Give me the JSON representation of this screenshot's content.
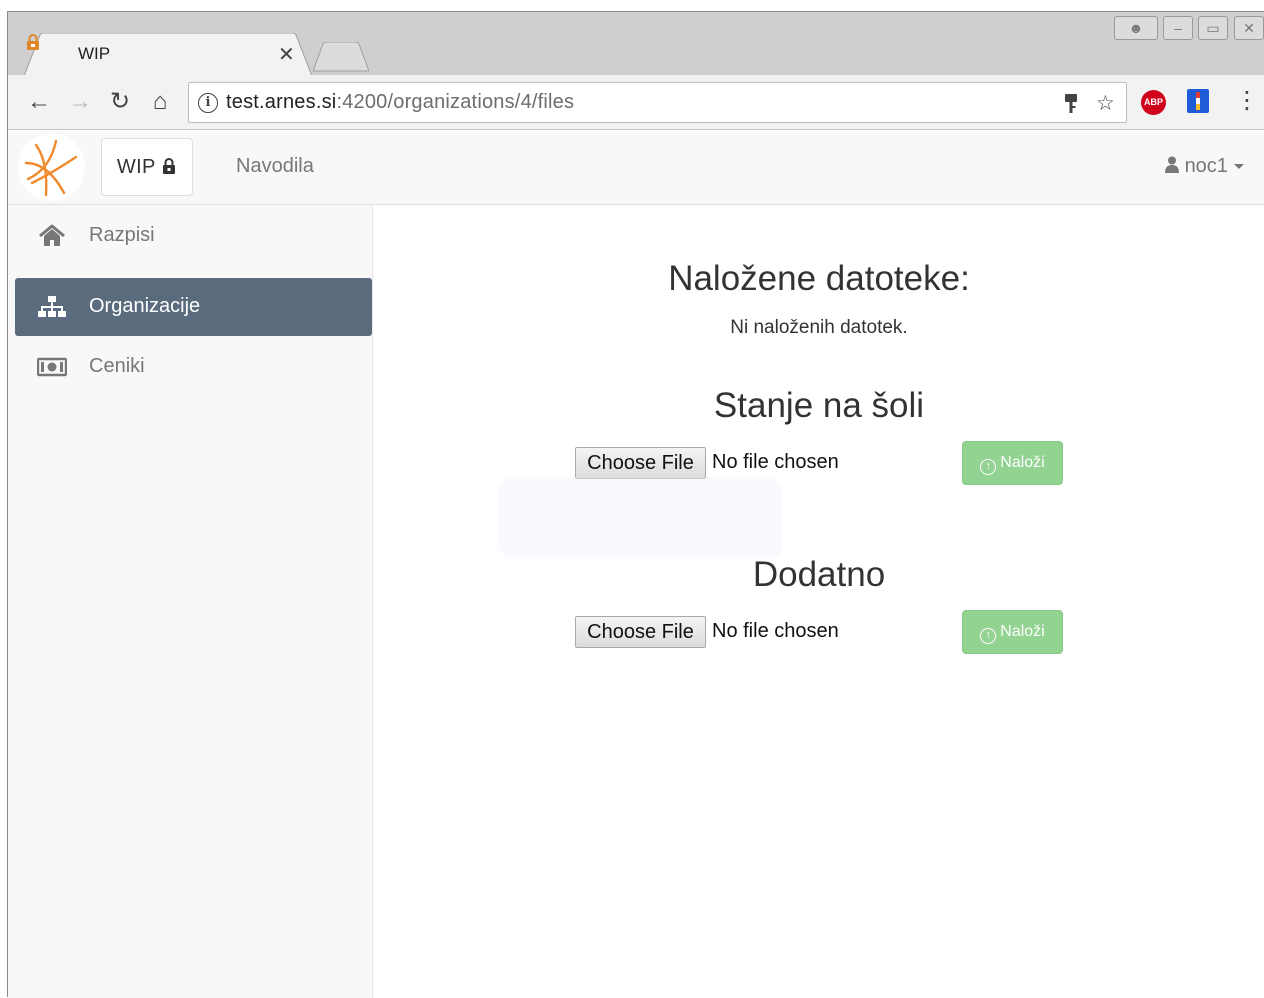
{
  "browser": {
    "tab": {
      "title": "WIP"
    },
    "url": {
      "host": "test.arnes.si",
      "rest": ":4200/organizations/4/files"
    },
    "extensions": {
      "abp_label": "ABP"
    }
  },
  "navbar": {
    "brand": "WIP",
    "link": "Navodila",
    "user": "noc1"
  },
  "sidebar": {
    "items": [
      {
        "label": "Razpisi",
        "icon": "home-icon"
      },
      {
        "label": "Organizacije",
        "icon": "sitemap-icon",
        "active": true
      },
      {
        "label": "Ceniki",
        "icon": "money-icon"
      }
    ]
  },
  "main": {
    "uploaded_title": "Naložene datoteke:",
    "empty_message": "Ni naloženih datotek.",
    "sections": [
      {
        "title": "Stanje na šoli",
        "choose_label": "Choose File",
        "file_status": "No file chosen",
        "upload_label": "Naloži"
      },
      {
        "title": "Dodatno",
        "choose_label": "Choose File",
        "file_status": "No file chosen",
        "upload_label": "Naloži"
      }
    ]
  },
  "colors": {
    "sidebar_active": "#5a6b7d",
    "upload_button": "#92d392",
    "logo_accent": "#f08a2c"
  }
}
